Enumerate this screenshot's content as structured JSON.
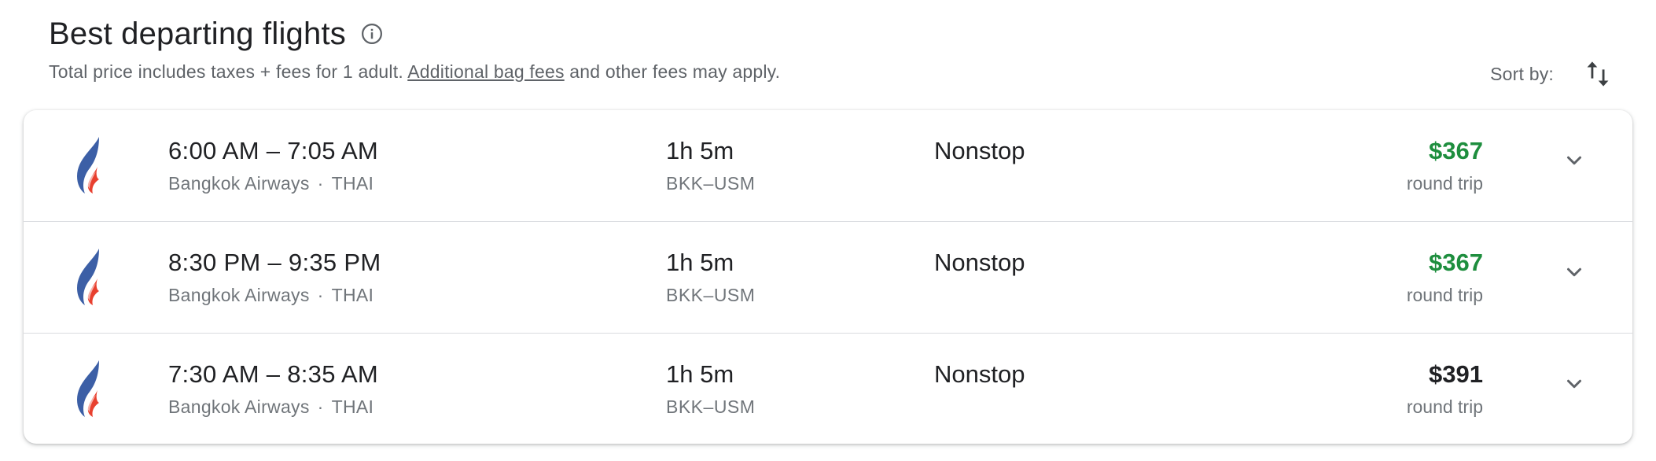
{
  "header": {
    "title": "Best departing flights",
    "subtitle_before": "Total price includes taxes + fees for 1 adult. ",
    "subtitle_link": "Additional bag fees",
    "subtitle_after": " and other fees may apply.",
    "sort_label": "Sort by:"
  },
  "icons": {
    "info": "info-icon",
    "sort": "swap-vertical-icon",
    "expand": "chevron-down-icon",
    "airline_logo": "bangkok-airways-logo"
  },
  "colors": {
    "cheap_price": "#1e8e3e",
    "normal_price": "#202124",
    "logo_blue": "#3c5fa6",
    "logo_red": "#e8402f"
  },
  "flights": [
    {
      "times": "6:00 AM – 7:05 AM",
      "airline": "Bangkok Airways",
      "operator": "THAI",
      "duration": "1h 5m",
      "route": "BKK–USM",
      "stops": "Nonstop",
      "price": "$367",
      "price_type": "round trip",
      "price_highlight": true
    },
    {
      "times": "8:30 PM – 9:35 PM",
      "airline": "Bangkok Airways",
      "operator": "THAI",
      "duration": "1h 5m",
      "route": "BKK–USM",
      "stops": "Nonstop",
      "price": "$367",
      "price_type": "round trip",
      "price_highlight": true
    },
    {
      "times": "7:30 AM – 8:35 AM",
      "airline": "Bangkok Airways",
      "operator": "THAI",
      "duration": "1h 5m",
      "route": "BKK–USM",
      "stops": "Nonstop",
      "price": "$391",
      "price_type": "round trip",
      "price_highlight": false
    }
  ]
}
